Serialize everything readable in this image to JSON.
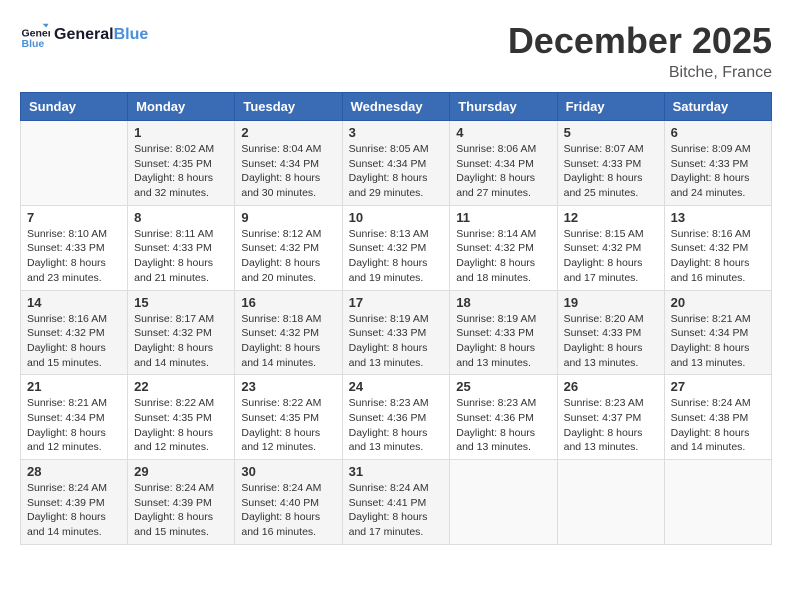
{
  "header": {
    "logo_line1": "General",
    "logo_line2": "Blue",
    "month_title": "December 2025",
    "location": "Bitche, France"
  },
  "days_of_week": [
    "Sunday",
    "Monday",
    "Tuesday",
    "Wednesday",
    "Thursday",
    "Friday",
    "Saturday"
  ],
  "weeks": [
    [
      {
        "day": "",
        "info": ""
      },
      {
        "day": "1",
        "info": "Sunrise: 8:02 AM\nSunset: 4:35 PM\nDaylight: 8 hours\nand 32 minutes."
      },
      {
        "day": "2",
        "info": "Sunrise: 8:04 AM\nSunset: 4:34 PM\nDaylight: 8 hours\nand 30 minutes."
      },
      {
        "day": "3",
        "info": "Sunrise: 8:05 AM\nSunset: 4:34 PM\nDaylight: 8 hours\nand 29 minutes."
      },
      {
        "day": "4",
        "info": "Sunrise: 8:06 AM\nSunset: 4:34 PM\nDaylight: 8 hours\nand 27 minutes."
      },
      {
        "day": "5",
        "info": "Sunrise: 8:07 AM\nSunset: 4:33 PM\nDaylight: 8 hours\nand 25 minutes."
      },
      {
        "day": "6",
        "info": "Sunrise: 8:09 AM\nSunset: 4:33 PM\nDaylight: 8 hours\nand 24 minutes."
      }
    ],
    [
      {
        "day": "7",
        "info": "Sunrise: 8:10 AM\nSunset: 4:33 PM\nDaylight: 8 hours\nand 23 minutes."
      },
      {
        "day": "8",
        "info": "Sunrise: 8:11 AM\nSunset: 4:33 PM\nDaylight: 8 hours\nand 21 minutes."
      },
      {
        "day": "9",
        "info": "Sunrise: 8:12 AM\nSunset: 4:32 PM\nDaylight: 8 hours\nand 20 minutes."
      },
      {
        "day": "10",
        "info": "Sunrise: 8:13 AM\nSunset: 4:32 PM\nDaylight: 8 hours\nand 19 minutes."
      },
      {
        "day": "11",
        "info": "Sunrise: 8:14 AM\nSunset: 4:32 PM\nDaylight: 8 hours\nand 18 minutes."
      },
      {
        "day": "12",
        "info": "Sunrise: 8:15 AM\nSunset: 4:32 PM\nDaylight: 8 hours\nand 17 minutes."
      },
      {
        "day": "13",
        "info": "Sunrise: 8:16 AM\nSunset: 4:32 PM\nDaylight: 8 hours\nand 16 minutes."
      }
    ],
    [
      {
        "day": "14",
        "info": "Sunrise: 8:16 AM\nSunset: 4:32 PM\nDaylight: 8 hours\nand 15 minutes."
      },
      {
        "day": "15",
        "info": "Sunrise: 8:17 AM\nSunset: 4:32 PM\nDaylight: 8 hours\nand 14 minutes."
      },
      {
        "day": "16",
        "info": "Sunrise: 8:18 AM\nSunset: 4:32 PM\nDaylight: 8 hours\nand 14 minutes."
      },
      {
        "day": "17",
        "info": "Sunrise: 8:19 AM\nSunset: 4:33 PM\nDaylight: 8 hours\nand 13 minutes."
      },
      {
        "day": "18",
        "info": "Sunrise: 8:19 AM\nSunset: 4:33 PM\nDaylight: 8 hours\nand 13 minutes."
      },
      {
        "day": "19",
        "info": "Sunrise: 8:20 AM\nSunset: 4:33 PM\nDaylight: 8 hours\nand 13 minutes."
      },
      {
        "day": "20",
        "info": "Sunrise: 8:21 AM\nSunset: 4:34 PM\nDaylight: 8 hours\nand 13 minutes."
      }
    ],
    [
      {
        "day": "21",
        "info": "Sunrise: 8:21 AM\nSunset: 4:34 PM\nDaylight: 8 hours\nand 12 minutes."
      },
      {
        "day": "22",
        "info": "Sunrise: 8:22 AM\nSunset: 4:35 PM\nDaylight: 8 hours\nand 12 minutes."
      },
      {
        "day": "23",
        "info": "Sunrise: 8:22 AM\nSunset: 4:35 PM\nDaylight: 8 hours\nand 12 minutes."
      },
      {
        "day": "24",
        "info": "Sunrise: 8:23 AM\nSunset: 4:36 PM\nDaylight: 8 hours\nand 13 minutes."
      },
      {
        "day": "25",
        "info": "Sunrise: 8:23 AM\nSunset: 4:36 PM\nDaylight: 8 hours\nand 13 minutes."
      },
      {
        "day": "26",
        "info": "Sunrise: 8:23 AM\nSunset: 4:37 PM\nDaylight: 8 hours\nand 13 minutes."
      },
      {
        "day": "27",
        "info": "Sunrise: 8:24 AM\nSunset: 4:38 PM\nDaylight: 8 hours\nand 14 minutes."
      }
    ],
    [
      {
        "day": "28",
        "info": "Sunrise: 8:24 AM\nSunset: 4:39 PM\nDaylight: 8 hours\nand 14 minutes."
      },
      {
        "day": "29",
        "info": "Sunrise: 8:24 AM\nSunset: 4:39 PM\nDaylight: 8 hours\nand 15 minutes."
      },
      {
        "day": "30",
        "info": "Sunrise: 8:24 AM\nSunset: 4:40 PM\nDaylight: 8 hours\nand 16 minutes."
      },
      {
        "day": "31",
        "info": "Sunrise: 8:24 AM\nSunset: 4:41 PM\nDaylight: 8 hours\nand 17 minutes."
      },
      {
        "day": "",
        "info": ""
      },
      {
        "day": "",
        "info": ""
      },
      {
        "day": "",
        "info": ""
      }
    ]
  ]
}
